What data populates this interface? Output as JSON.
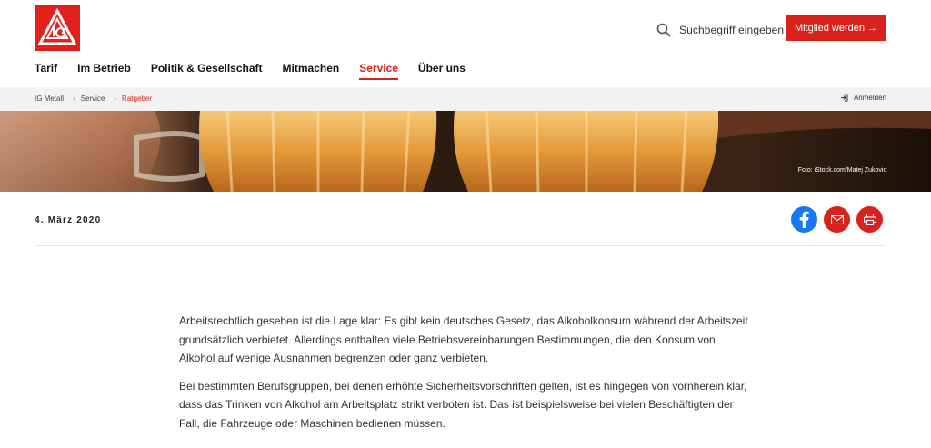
{
  "header": {
    "search_label": "Suchbegriff eingeben",
    "cta_label": "Mitglied werden →"
  },
  "nav": {
    "items": [
      {
        "label": "Tarif",
        "active": false
      },
      {
        "label": "Im Betrieb",
        "active": false
      },
      {
        "label": "Politik & Gesellschaft",
        "active": false
      },
      {
        "label": "Mitmachen",
        "active": false
      },
      {
        "label": "Service",
        "active": true
      },
      {
        "label": "Über uns",
        "active": false
      }
    ]
  },
  "breadcrumb": {
    "items": [
      "IG Metall",
      "Service",
      "Ratgeber"
    ],
    "login_label": "Anmelden"
  },
  "hero": {
    "credit": "Foto: iStock.com/Matej Zukovic"
  },
  "article": {
    "date": "4. März 2020",
    "paragraphs": [
      "Arbeitsrechtlich gesehen ist die Lage klar: Es gibt kein deutsches Gesetz, das Alkoholkonsum während der Arbeitszeit grundsätzlich verbietet. Allerdings enthalten viele Betriebsvereinbarungen Bestimmungen, die den Konsum von Alkohol auf wenige Ausnahmen begrenzen oder ganz verbieten.",
      "Bei bestimmten Berufsgruppen, bei denen erhöhte Sicherheitsvorschriften gelten, ist es hingegen von vornherein klar, dass das Trinken von Alkohol am Arbeitsplatz strikt verboten ist. Das ist beispielsweise bei vielen Beschäftigten der Fall, die Fahrzeuge oder Maschinen bedienen müssen."
    ]
  },
  "colors": {
    "brand_red": "#d8231d",
    "facebook_blue": "#1877f2"
  }
}
